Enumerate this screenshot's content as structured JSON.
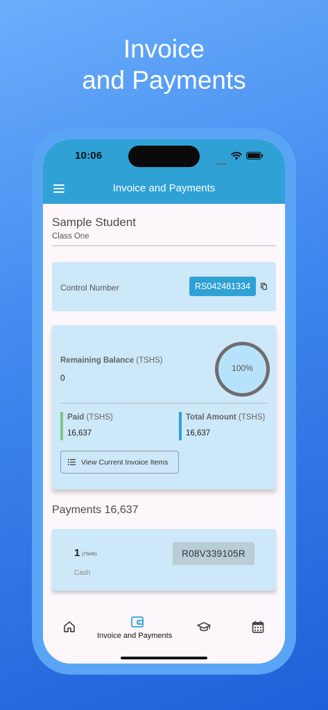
{
  "promo": {
    "line1": "Invoice",
    "line2": "and Payments"
  },
  "status_bar": {
    "time": "10:06"
  },
  "app_bar": {
    "title": "Invoice and Payments"
  },
  "student": {
    "name": "Sample Student",
    "class": "Class One"
  },
  "control": {
    "label": "Control Number",
    "number": "RS042481334"
  },
  "balance": {
    "label": "Remaining Balance",
    "unit": "(TSHS)",
    "value": "0",
    "progress_label": "100%",
    "progress_fraction": 1.0,
    "paid": {
      "label": "Paid",
      "unit": "(TSHS)",
      "value": "16,637"
    },
    "total": {
      "label": "Total Amount",
      "unit": "(TSHS)",
      "value": "16,637"
    },
    "view_items_label": "View Current Invoice Items"
  },
  "payments": {
    "heading": "Payments 16,637",
    "items": [
      {
        "amount": "1",
        "unit": "(TSHS)",
        "method": "Cash",
        "receipt": "R08V339105R"
      }
    ]
  },
  "bottom_nav": {
    "items": [
      {
        "icon": "home-icon",
        "label": ""
      },
      {
        "icon": "wallet-icon",
        "label": "Invoice and Payments"
      },
      {
        "icon": "graduation-cap-icon",
        "label": ""
      },
      {
        "icon": "calendar-icon",
        "label": ""
      }
    ]
  },
  "colors": {
    "primary": "#2fa1d5",
    "card": "#cde8f8",
    "paid_bar": "#7cc587",
    "receipt_chip": "#b9cdd7"
  }
}
